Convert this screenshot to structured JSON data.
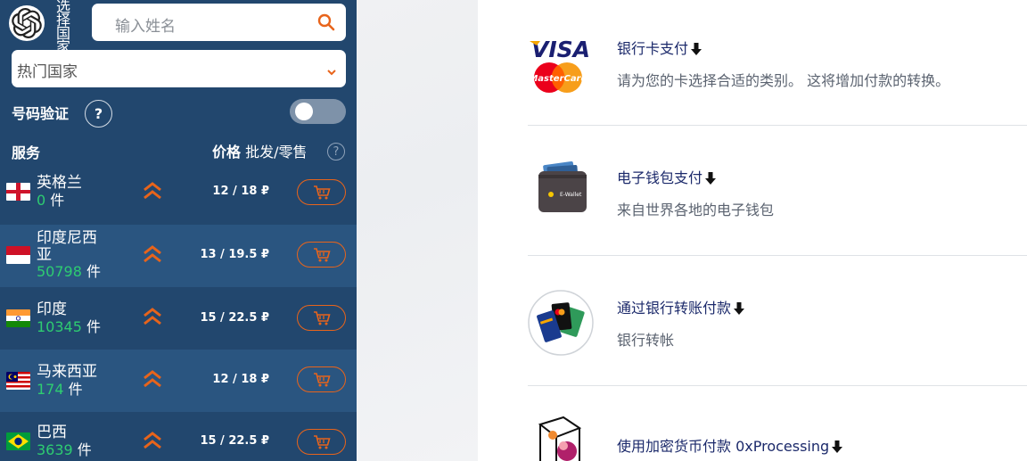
{
  "sidebar": {
    "country_label": "选择国家",
    "search_placeholder": "输入姓名",
    "country_select": "热门国家",
    "verify_label": "号码验证",
    "help_symbol": "?",
    "header_service": "服务",
    "header_price_bold": "价格",
    "header_price_rest": " 批发/零售",
    "currency": "₽",
    "rows": [
      {
        "name": "英格兰",
        "count": "0",
        "unit": " 件",
        "price_wholesale": "12",
        "price_retail": "18 ₽",
        "flag": "england"
      },
      {
        "name": "印度尼西亚",
        "count": "50798",
        "unit": " 件",
        "price_wholesale": "13",
        "price_retail": "19.5 ₽",
        "flag": "indonesia"
      },
      {
        "name": "印度",
        "count": "10345",
        "unit": " 件",
        "price_wholesale": "15",
        "price_retail": "22.5 ₽",
        "flag": "india"
      },
      {
        "name": "马来西亚",
        "count": "174",
        "unit": " 件",
        "price_wholesale": "12",
        "price_retail": "18 ₽",
        "flag": "malaysia"
      },
      {
        "name": "巴西",
        "count": "3639",
        "unit": " 件",
        "price_wholesale": "15",
        "price_retail": "22.5 ₽",
        "flag": "brazil"
      }
    ]
  },
  "payments": [
    {
      "title": "银行卡支付",
      "desc": "请为您的卡选择合适的类别。 这将增加付款的转换。",
      "icon": "visa-mastercard-icon"
    },
    {
      "title": "电子钱包支付",
      "desc": "来自世界各地的电子钱包",
      "icon": "ewallet-icon"
    },
    {
      "title": "通过银行转账付款",
      "desc": "银行转帐",
      "icon": "bank-cards-icon"
    },
    {
      "title": "使用加密货币付款 0xProcessing",
      "desc": "",
      "icon": "crypto-cube-icon"
    }
  ],
  "wallet_text": "E-Wallet",
  "visa_text": "VISA",
  "mastercard_text": "MasterCard",
  "colors": {
    "sidebar": "#22476e",
    "accent": "#e8641b",
    "count_green": "#2ecc71",
    "title": "#1c2a6b"
  }
}
